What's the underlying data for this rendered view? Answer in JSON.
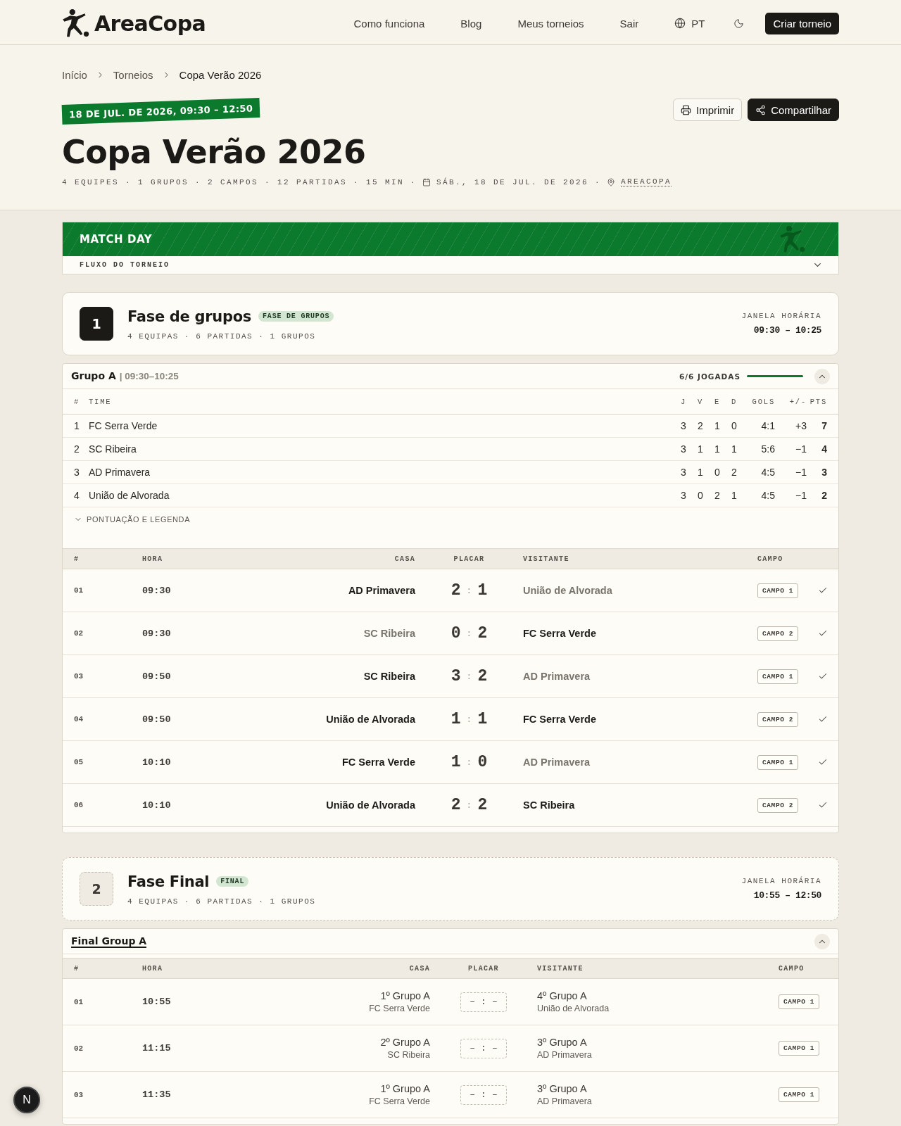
{
  "header": {
    "brand": "AreaCopa",
    "nav": [
      {
        "label": "Como funciona"
      },
      {
        "label": "Blog"
      },
      {
        "label": "Meus torneios"
      },
      {
        "label": "Sair"
      }
    ],
    "language": "PT",
    "cta": "Criar torneio"
  },
  "breadcrumb": [
    {
      "label": "Início",
      "current": false
    },
    {
      "label": "Torneios",
      "current": false
    },
    {
      "label": "Copa Verão 2026",
      "current": true
    }
  ],
  "tournament": {
    "date_tag": "18 DE JUL. DE 2026, 09:30 – 12:50",
    "title": "Copa Verão 2026",
    "stats": "4 EQUIPES · 1 GRUPOS · 2 CAMPOS · 12 PARTIDAS · 15 MIN ·",
    "date": "SÁB., 18 DE JUL. DE 2026 ·",
    "location": "AREACOPA",
    "actions": [
      {
        "kind": "print",
        "label": "Imprimir"
      },
      {
        "kind": "share",
        "label": "Compartilhar"
      }
    ]
  },
  "banner": {
    "title": "MATCH DAY",
    "flow_label": "FLUXO DO TORNEIO",
    "expanded": false
  },
  "stages": [
    {
      "number": "1",
      "title": "Fase de grupos",
      "tag": "FASE DE GRUPOS",
      "stats": "4 EQUIPAS · 6 PARTIDAS · 1 GRUPOS",
      "window_label": "JANELA HORÁRIA",
      "window": "09:30 – 10:25",
      "pending": false,
      "groups": [
        {
          "title": "Grupo A",
          "link": false,
          "time_window": "| 09:30–10:25",
          "progress": {
            "label": "6/6 JOGADAS",
            "level": 1
          },
          "expanded": true,
          "standings": {
            "columns": [
              "#",
              "TIME",
              "J",
              "V",
              "E",
              "D",
              "GOLS",
              "+/-",
              "PTS"
            ],
            "rows": [
              {
                "rank": "1",
                "team": "FC Serra Verde",
                "stats": [
                  "3",
                  "2",
                  "1",
                  "0",
                  "4:1",
                  "+3"
                ],
                "points": "7"
              },
              {
                "rank": "2",
                "team": "SC Ribeira",
                "stats": [
                  "3",
                  "1",
                  "1",
                  "1",
                  "5:6",
                  "−1"
                ],
                "points": "4"
              },
              {
                "rank": "3",
                "team": "AD Primavera",
                "stats": [
                  "3",
                  "1",
                  "0",
                  "2",
                  "4:5",
                  "−1"
                ],
                "points": "3"
              },
              {
                "rank": "4",
                "team": "União de Alvorada",
                "stats": [
                  "3",
                  "0",
                  "2",
                  "1",
                  "4:5",
                  "−1"
                ],
                "points": "2"
              }
            ]
          },
          "legend": {
            "label": "PONTUAÇÃO E LEGENDA",
            "expanded": false
          },
          "matches": {
            "columns": [
              "#",
              "HORA",
              "CASA",
              "PLACAR",
              "VISITANTE",
              "CAMPO"
            ],
            "rows": [
              {
                "kind": "played",
                "number": "01",
                "time": "09:30",
                "home": {
                  "name": "AD Primavera",
                  "lost": false
                },
                "score": [
                  "2",
                  ":",
                  "1"
                ],
                "away": {
                  "name": "União de Alvorada",
                  "lost": true
                },
                "field": "CAMPO 1",
                "done": true
              },
              {
                "kind": "played",
                "number": "02",
                "time": "09:30",
                "home": {
                  "name": "SC Ribeira",
                  "lost": true
                },
                "score": [
                  "0",
                  ":",
                  "2"
                ],
                "away": {
                  "name": "FC Serra Verde",
                  "lost": false
                },
                "field": "CAMPO 2",
                "done": true
              },
              {
                "kind": "played",
                "number": "03",
                "time": "09:50",
                "home": {
                  "name": "SC Ribeira",
                  "lost": false
                },
                "score": [
                  "3",
                  ":",
                  "2"
                ],
                "away": {
                  "name": "AD Primavera",
                  "lost": true
                },
                "field": "CAMPO 1",
                "done": true
              },
              {
                "kind": "played",
                "number": "04",
                "time": "09:50",
                "home": {
                  "name": "União de Alvorada",
                  "lost": false
                },
                "score": [
                  "1",
                  ":",
                  "1"
                ],
                "away": {
                  "name": "FC Serra Verde",
                  "lost": false
                },
                "field": "CAMPO 2",
                "done": true
              },
              {
                "kind": "played",
                "number": "05",
                "time": "10:10",
                "home": {
                  "name": "FC Serra Verde",
                  "lost": false
                },
                "score": [
                  "1",
                  ":",
                  "0"
                ],
                "away": {
                  "name": "AD Primavera",
                  "lost": true
                },
                "field": "CAMPO 1",
                "done": true
              },
              {
                "kind": "played",
                "number": "06",
                "time": "10:10",
                "home": {
                  "name": "União de Alvorada",
                  "lost": false
                },
                "score": [
                  "2",
                  ":",
                  "2"
                ],
                "away": {
                  "name": "SC Ribeira",
                  "lost": false
                },
                "field": "CAMPO 2",
                "done": true
              }
            ]
          }
        }
      ]
    },
    {
      "number": "2",
      "title": "Fase Final",
      "tag": "FINAL",
      "stats": "4 EQUIPAS · 6 PARTIDAS · 1 GRUPOS",
      "window_label": "JANELA HORÁRIA",
      "window": "10:55 – 12:50",
      "pending": true,
      "groups": [
        {
          "title": "Final Group A",
          "link": true,
          "expanded": true,
          "matches": {
            "columns": [
              "#",
              "HORA",
              "CASA",
              "PLACAR",
              "VISITANTE",
              "CAMPO"
            ],
            "rows": [
              {
                "kind": "scheduled",
                "number": "01",
                "time": "10:55",
                "home": {
                  "seed": "1º Grupo A",
                  "name": "FC Serra Verde"
                },
                "score": [
                  "–",
                  ":",
                  "–"
                ],
                "away": {
                  "seed": "4º Grupo A",
                  "name": "União de Alvorada"
                },
                "field": "CAMPO 1",
                "done": false
              },
              {
                "kind": "scheduled",
                "number": "02",
                "time": "11:15",
                "home": {
                  "seed": "2º Grupo A",
                  "name": "SC Ribeira"
                },
                "score": [
                  "–",
                  ":",
                  "–"
                ],
                "away": {
                  "seed": "3º Grupo A",
                  "name": "AD Primavera"
                },
                "field": "CAMPO 1",
                "done": false
              },
              {
                "kind": "scheduled",
                "number": "03",
                "time": "11:35",
                "home": {
                  "seed": "1º Grupo A",
                  "name": "FC Serra Verde"
                },
                "score": [
                  "–",
                  ":",
                  "–"
                ],
                "away": {
                  "seed": "3º Grupo A",
                  "name": "AD Primavera"
                },
                "field": "CAMPO 1",
                "done": false
              }
            ]
          }
        }
      ]
    }
  ],
  "dev_badge": "N"
}
